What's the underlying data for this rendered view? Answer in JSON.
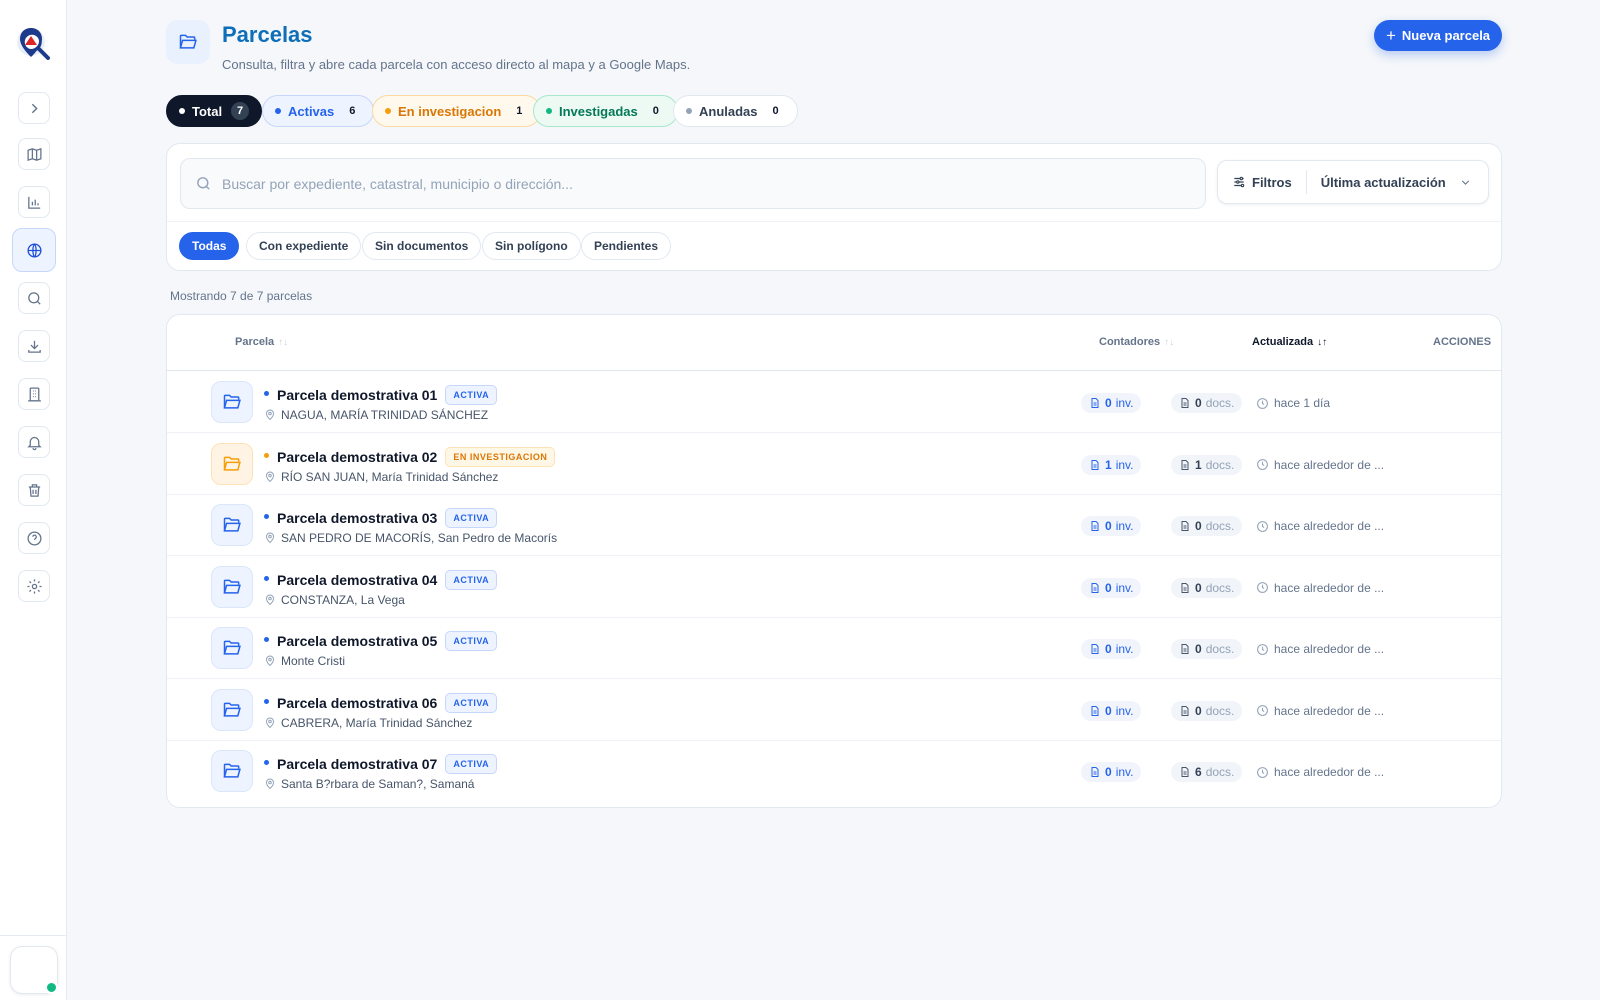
{
  "header": {
    "title": "Parcelas",
    "subtitle": "Consulta, filtra y abre cada parcela con acceso directo al mapa y a Google Maps.",
    "new_button": "Nueva parcela"
  },
  "status_pills": [
    {
      "label": "Total",
      "count": "7",
      "color": "#0f172a"
    },
    {
      "label": "Activas",
      "count": "6",
      "color": "#2563eb"
    },
    {
      "label": "En investigacion",
      "count": "1",
      "color": "#f59e0b"
    },
    {
      "label": "Investigadas",
      "count": "0",
      "color": "#10b981"
    },
    {
      "label": "Anuladas",
      "count": "0",
      "color": "#94a3b8"
    }
  ],
  "search": {
    "placeholder": "Buscar por expediente, catastral, municipio o dirección...",
    "filters_label": "Filtros",
    "sort_value": "Última actualización"
  },
  "chips": [
    "Todas",
    "Con expediente",
    "Sin documentos",
    "Sin polígono",
    "Pendientes"
  ],
  "showing": "Mostrando 7 de 7 parcelas",
  "table": {
    "columns": {
      "parcela": "Parcela",
      "contadores": "Contadores",
      "actualizada": "Actualizada",
      "acciones": "ACCIONES"
    },
    "rows": [
      {
        "name": "Parcela demostrativa 01",
        "badge": "ACTIVA",
        "status": "active",
        "location": "NAGUA, MARÍA TRINIDAD SÁNCHEZ",
        "inv": "0",
        "inv_unit": "inv.",
        "docs": "0",
        "docs_unit": "docs.",
        "updated": "hace 1 día"
      },
      {
        "name": "Parcela demostrativa 02",
        "badge": "EN INVESTIGACION",
        "status": "investigation",
        "location": "RÍO SAN JUAN, María Trinidad Sánchez",
        "inv": "1",
        "inv_unit": "inv.",
        "docs": "1",
        "docs_unit": "docs.",
        "updated": "hace alrededor de ..."
      },
      {
        "name": "Parcela demostrativa 03",
        "badge": "ACTIVA",
        "status": "active",
        "location": "SAN PEDRO DE MACORÍS, San Pedro de Macorís",
        "inv": "0",
        "inv_unit": "inv.",
        "docs": "0",
        "docs_unit": "docs.",
        "updated": "hace alrededor de ..."
      },
      {
        "name": "Parcela demostrativa 04",
        "badge": "ACTIVA",
        "status": "active",
        "location": "CONSTANZA, La Vega",
        "inv": "0",
        "inv_unit": "inv.",
        "docs": "0",
        "docs_unit": "docs.",
        "updated": "hace alrededor de ..."
      },
      {
        "name": "Parcela demostrativa 05",
        "badge": "ACTIVA",
        "status": "active",
        "location": "Monte Cristi",
        "inv": "0",
        "inv_unit": "inv.",
        "docs": "0",
        "docs_unit": "docs.",
        "updated": "hace alrededor de ..."
      },
      {
        "name": "Parcela demostrativa 06",
        "badge": "ACTIVA",
        "status": "active",
        "location": "CABRERA, María Trinidad Sánchez",
        "inv": "0",
        "inv_unit": "inv.",
        "docs": "0",
        "docs_unit": "docs.",
        "updated": "hace alrededor de ..."
      },
      {
        "name": "Parcela demostrativa 07",
        "badge": "ACTIVA",
        "status": "active",
        "location": "Santa B?rbara de Saman?, Samaná",
        "inv": "0",
        "inv_unit": "inv.",
        "docs": "6",
        "docs_unit": "docs.",
        "updated": "hace alrededor de ..."
      }
    ]
  },
  "sidebar": {
    "icons": [
      "chevron-right-icon",
      "map-icon",
      "bar-chart-icon",
      "globe-icon",
      "search-icon",
      "download-icon",
      "building-icon",
      "bell-icon",
      "trash-icon",
      "help-icon",
      "settings-icon"
    ],
    "active": "globe-icon"
  },
  "colors": {
    "accent": "#2563eb",
    "title": "#0f6eb8",
    "warning": "#f59e0b",
    "success": "#10b981"
  }
}
